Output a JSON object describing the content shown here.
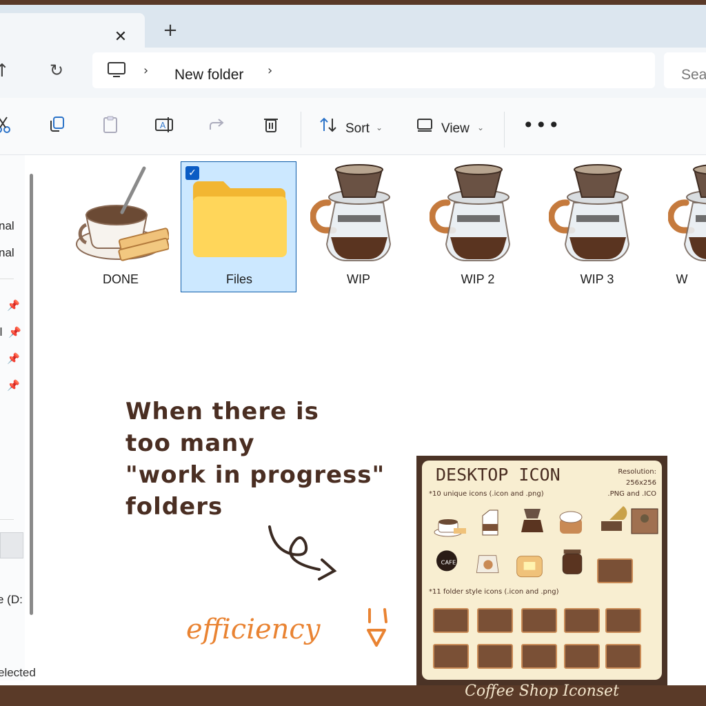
{
  "address": {
    "location": "New folder",
    "search_placeholder": "Sea"
  },
  "toolbar": {
    "sort_label": "Sort",
    "view_label": "View"
  },
  "sidebar": {
    "items": [
      "nal",
      "nal",
      "(l",
      "e (D:"
    ]
  },
  "status": "elected",
  "files": [
    {
      "name": "DONE",
      "icon": "coffee-cup-icon",
      "selected": false
    },
    {
      "name": "Files",
      "icon": "folder-icon",
      "selected": true
    },
    {
      "name": "WIP",
      "icon": "coffee-dripper-icon",
      "selected": false
    },
    {
      "name": "WIP 2",
      "icon": "coffee-dripper-icon",
      "selected": false
    },
    {
      "name": "WIP 3",
      "icon": "coffee-dripper-icon",
      "selected": false
    },
    {
      "name": "W",
      "icon": "coffee-dripper-icon",
      "selected": false
    }
  ],
  "caption": {
    "line1": "When there is",
    "line2": "too many",
    "line3": "\"work in progress\"",
    "line4": "folders"
  },
  "efficiency": "efficiency",
  "card": {
    "title": "DESKTOP ICON",
    "resolution": "Resolution: 256x256",
    "formats": ".PNG and .ICO",
    "unique": "*10 unique icons (.icon and .png)",
    "folders": "*11 folder style icons (.icon and .png)",
    "footer": "Coffee Shop Iconset"
  },
  "colors": {
    "accent": "#0a5bc4",
    "brown": "#4a2e22",
    "orange": "#e98332",
    "cream": "#f8eed1"
  }
}
